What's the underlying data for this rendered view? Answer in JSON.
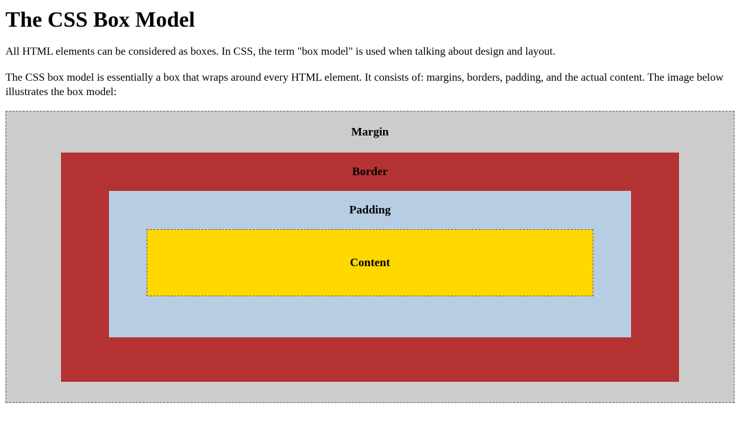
{
  "title": "The CSS Box Model",
  "intro1": "All HTML elements can be considered as boxes. In CSS, the term \"box model\" is used when talking about design and layout.",
  "intro2": "The CSS box model is essentially a box that wraps around every HTML element. It consists of: margins, borders, padding, and the actual content. The image below illustrates the box model:",
  "diagram": {
    "margin": "Margin",
    "border": "Border",
    "padding": "Padding",
    "content": "Content"
  },
  "colors": {
    "margin_bg": "#cccccc",
    "border_bg": "#b43232",
    "padding_bg": "#b6cde4",
    "content_bg": "#ffd800"
  }
}
